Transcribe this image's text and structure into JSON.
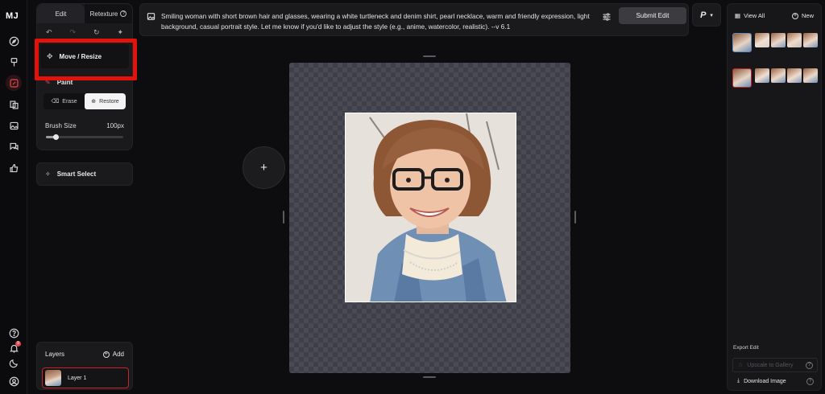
{
  "app": {
    "logo": "MJ"
  },
  "rail": {
    "icons": [
      "compass-icon",
      "brush-icon",
      "edit-icon",
      "layers-icon",
      "image-icon",
      "chat-icon",
      "thumbs-up-icon"
    ],
    "bottom_icons": [
      "help-icon",
      "bell-icon",
      "moon-icon",
      "profile-icon"
    ],
    "notification_count": "9"
  },
  "panel": {
    "tabs": [
      {
        "label": "Edit"
      },
      {
        "label": "Retexture"
      }
    ],
    "move_resize_label": "Move / Resize",
    "paint_label": "Paint",
    "erase_label": "Erase",
    "restore_label": "Restore",
    "brush_size_label": "Brush Size",
    "brush_size_value": "100px",
    "brush_level": 0.12,
    "smart_select_label": "Smart Select"
  },
  "layers": {
    "title": "Layers",
    "add_label": "Add",
    "items": [
      {
        "label": "Layer 1"
      }
    ]
  },
  "prompt": {
    "text": "Smiling woman with short brown hair and glasses, wearing a white turtleneck and denim shirt, pearl necklace, warm and friendly expression, light background, casual portrait style. Let me know if you'd like to adjust the style (e.g., anime, watercolor, realistic). --v 6.1",
    "submit_label": "Submit Edit",
    "personalize_label": "P"
  },
  "right_panel": {
    "view_all_label": "View All",
    "new_label": "New",
    "export_label": "Export Edit",
    "upscale_label": "Upscale to Gallery",
    "download_label": "Download Image"
  },
  "colors": {
    "accent": "#e0484e",
    "highlight": "#e3120b"
  }
}
